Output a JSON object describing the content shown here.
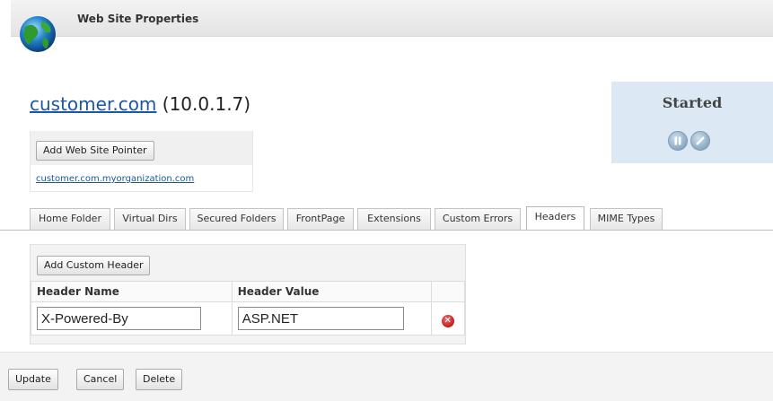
{
  "window": {
    "title": "Web Site Properties"
  },
  "site": {
    "name": "customer.com",
    "ip": "(10.0.1.7)"
  },
  "status": {
    "text": "Started",
    "pause_icon": "pause-icon",
    "stop_icon": "stop-icon"
  },
  "pointer": {
    "add_button": "Add Web Site Pointer",
    "link": "customer.com.myorganization.com"
  },
  "tabs": [
    {
      "label": "Home Folder",
      "active": false
    },
    {
      "label": "Virtual Dirs",
      "active": false
    },
    {
      "label": "Secured Folders",
      "active": false
    },
    {
      "label": "FrontPage",
      "active": false
    },
    {
      "label": "Extensions",
      "active": false
    },
    {
      "label": "Custom Errors",
      "active": false
    },
    {
      "label": "Headers",
      "active": true
    },
    {
      "label": "MIME Types",
      "active": false
    }
  ],
  "headers_panel": {
    "add_button": "Add Custom Header",
    "columns": [
      "Header Name",
      "Header Value"
    ],
    "rows": [
      {
        "name": "X-Powered-By",
        "value": "ASP.NET",
        "delete_icon": "delete-icon"
      }
    ]
  },
  "footer": {
    "update": "Update",
    "cancel": "Cancel",
    "delete": "Delete"
  }
}
